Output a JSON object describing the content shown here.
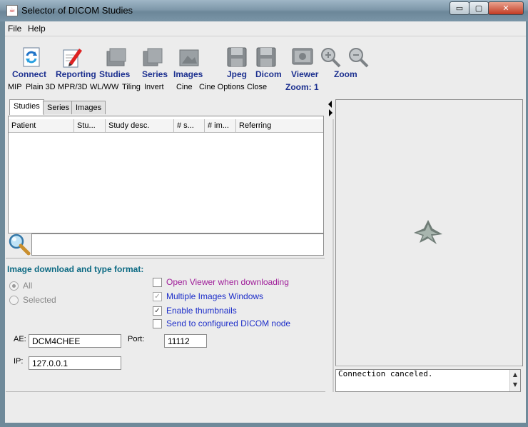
{
  "window": {
    "title": "Selector of DICOM Studies",
    "minimize_glyph": "▭",
    "maximize_glyph": "▢",
    "close_glyph": "✕"
  },
  "menu": [
    "File",
    "Help"
  ],
  "toolbar": {
    "buttons": [
      {
        "label": "Connect",
        "icon": "connect-icon"
      },
      {
        "label": "Reporting",
        "icon": "reporting-icon"
      },
      {
        "label": "Studies",
        "icon": "studies-icon"
      },
      {
        "label": "Series",
        "icon": "series-icon"
      },
      {
        "label": "Images",
        "icon": "images-icon"
      },
      {
        "label": "Jpeg",
        "icon": "jpeg-save-icon"
      },
      {
        "label": "Dicom",
        "icon": "dicom-save-icon"
      },
      {
        "label": "Viewer",
        "icon": "viewer-icon"
      },
      {
        "label": "Zoom",
        "icon": "zoom-icons"
      }
    ],
    "sub_items": [
      "MIP",
      "Plain 3D",
      "MPR/3D",
      "WL/WW",
      "Tiling",
      "Invert",
      "Cine",
      "Cine Options",
      "Close"
    ],
    "zoom_level": "Zoom: 1"
  },
  "tabs": [
    "Studies",
    "Series",
    "Images"
  ],
  "table": {
    "columns": [
      "Patient",
      "Stu...",
      "Study desc.",
      "# s...",
      "# im...",
      "Referring"
    ],
    "rows": []
  },
  "download": {
    "title": "Image download and type format:",
    "radio_all": "All",
    "radio_selected": "Selected",
    "options": [
      {
        "label": "Open Viewer when downloading",
        "checked": false,
        "color": "#a0209a"
      },
      {
        "label": "Multiple Images Windows",
        "checked": true,
        "color": "#1d2ec9"
      },
      {
        "label": "Enable thumbnails",
        "checked": true,
        "color": "#1d2ec9"
      },
      {
        "label": "Send to configured DICOM node",
        "checked": false,
        "color": "#1d2ec9"
      }
    ],
    "ae_label": "AE:",
    "ae_value": "DCM4CHEE",
    "port_label": "Port:",
    "port_value": "11112",
    "ip_label": "IP:",
    "ip_value": "127.0.0.1"
  },
  "console": {
    "text": "Connection canceled."
  },
  "colors": {
    "toolbar_label": "#1b2f8f",
    "section_title": "#0c6a83"
  }
}
